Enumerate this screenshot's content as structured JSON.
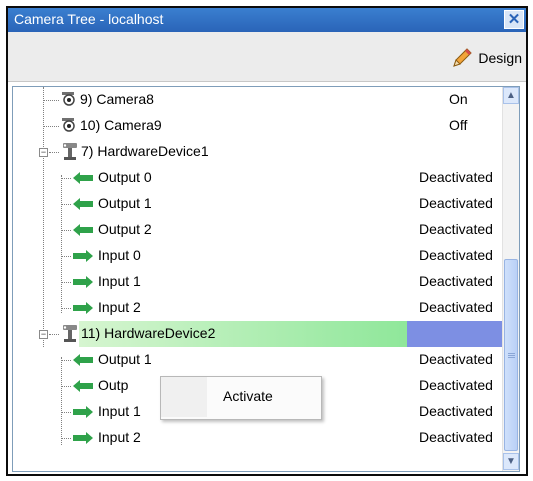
{
  "window": {
    "title": "Camera Tree - localhost"
  },
  "titlebar": {
    "close_glyph": "✕"
  },
  "toolbar": {
    "design_label": "Design",
    "design_icon": "pencil-icon"
  },
  "tree": {
    "rows": [
      {
        "label": "9) Camera8",
        "status": "On",
        "icon": "camera-icon"
      },
      {
        "label": "10) Camera9",
        "status": "Off",
        "icon": "camera-icon"
      },
      {
        "label": "7) HardwareDevice1",
        "status": "",
        "icon": "hardware-device-icon",
        "expander": "−"
      },
      {
        "label": "Output 0",
        "status": "Deactivated",
        "icon": "output-arrow-icon"
      },
      {
        "label": "Output 1",
        "status": "Deactivated",
        "icon": "output-arrow-icon"
      },
      {
        "label": "Output 2",
        "status": "Deactivated",
        "icon": "output-arrow-icon"
      },
      {
        "label": "Input 0",
        "status": "Deactivated",
        "icon": "input-arrow-icon"
      },
      {
        "label": "Input 1",
        "status": "Deactivated",
        "icon": "input-arrow-icon"
      },
      {
        "label": "Input 2",
        "status": "Deactivated",
        "icon": "input-arrow-icon"
      },
      {
        "label": "11) HardwareDevice2",
        "status": "",
        "icon": "hardware-device-icon",
        "expander": "−",
        "selected": true
      },
      {
        "label": "Output 1",
        "status": "Deactivated",
        "icon": "output-arrow-icon"
      },
      {
        "label": "Outp",
        "status": "Deactivated",
        "icon": "output-arrow-icon"
      },
      {
        "label": "Input 1",
        "status": "Deactivated",
        "icon": "input-arrow-icon"
      },
      {
        "label": "Input 2",
        "status": "Deactivated",
        "icon": "input-arrow-icon"
      }
    ]
  },
  "context_menu": {
    "items": [
      {
        "label": "Activate"
      }
    ]
  },
  "colors": {
    "titlebar": "#2a64b8",
    "selection_green": "#8fe79a",
    "selection_blue": "#7d8fe3",
    "arrow_green": "#2fa24a"
  }
}
